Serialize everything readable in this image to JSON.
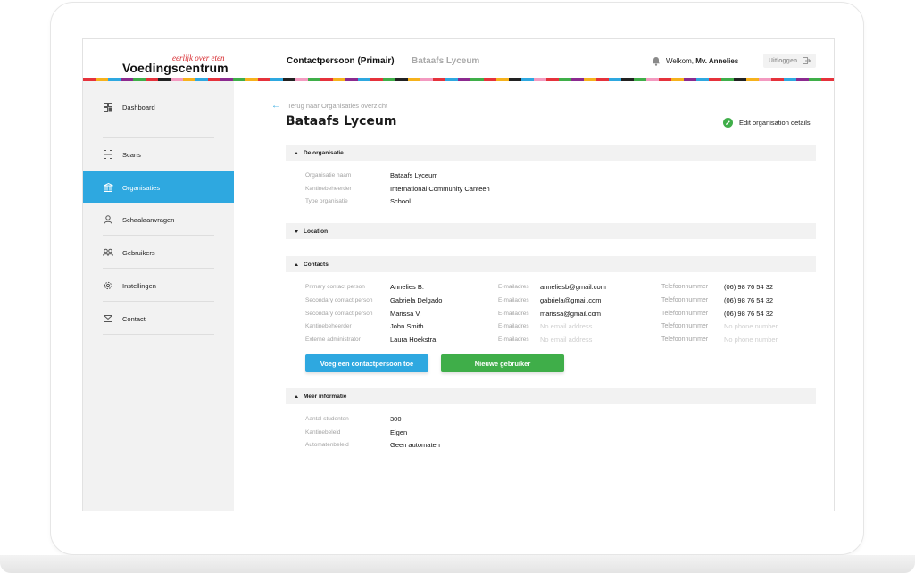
{
  "header": {
    "logo_tagline": "eerlijk over eten",
    "logo_name": "Voedingscentrum",
    "nav_primary": "Contactpersoon (Primair)",
    "nav_secondary": "Bataafs Lyceum",
    "welcome_prefix": "Welkom, ",
    "welcome_name": "Mv. Annelies",
    "logout_label": "Uitloggen",
    "stripe_colors": [
      "#e5323b",
      "#f6b21c",
      "#2ea8e0",
      "#8b2a8f",
      "#3fae49",
      "#e5323b",
      "#222222",
      "#f39ac0",
      "#f6b21c",
      "#2ea8e0",
      "#e5323b",
      "#8b2a8f",
      "#3fae49",
      "#f6b21c",
      "#e5323b",
      "#2ea8e0",
      "#222222",
      "#f39ac0",
      "#3fae49",
      "#e5323b",
      "#f6b21c",
      "#8b2a8f",
      "#2ea8e0",
      "#e5323b",
      "#3fae49",
      "#222222",
      "#f6b21c",
      "#f39ac0",
      "#e5323b",
      "#2ea8e0",
      "#8b2a8f",
      "#3fae49",
      "#e5323b",
      "#f6b21c",
      "#222222",
      "#2ea8e0",
      "#f39ac0",
      "#e5323b",
      "#3fae49",
      "#8b2a8f",
      "#f6b21c",
      "#e5323b",
      "#2ea8e0",
      "#222222",
      "#3fae49",
      "#f39ac0",
      "#e5323b",
      "#f6b21c",
      "#8b2a8f",
      "#2ea8e0",
      "#e5323b",
      "#3fae49",
      "#222222",
      "#f6b21c",
      "#f39ac0",
      "#e5323b",
      "#2ea8e0",
      "#8b2a8f",
      "#3fae49",
      "#e5323b"
    ]
  },
  "sidebar": {
    "items": [
      {
        "label": "Dashboard",
        "icon": "dashboard-icon"
      },
      {
        "label": "Scans",
        "icon": "scan-icon"
      },
      {
        "label": "Organisaties",
        "icon": "building-icon",
        "active": true
      },
      {
        "label": "Schaalaanvragen",
        "icon": "user-request-icon"
      },
      {
        "label": "Gebruikers",
        "icon": "users-icon"
      },
      {
        "label": "Instellingen",
        "icon": "gear-icon"
      },
      {
        "label": "Contact",
        "icon": "mail-icon"
      }
    ]
  },
  "main": {
    "back_link": "Terug naar Organisaties overzicht",
    "title": "Bataafs Lyceum",
    "edit_label": "Edit organisation details",
    "sections": {
      "organisatie": {
        "title": "De organisatie",
        "rows": [
          {
            "label": "Organisatie naam",
            "value": "Bataafs Lyceum"
          },
          {
            "label": "Kantinebeheerder",
            "value": "International Community Canteen"
          },
          {
            "label": "Type organisatie",
            "value": "School"
          }
        ]
      },
      "location": {
        "title": "Location"
      },
      "contacts": {
        "title": "Contacts",
        "email_label": "E-mailadres",
        "phone_label": "Telefoonnummer",
        "rows": [
          {
            "role": "Primary contact person",
            "name": "Annelies B.",
            "email": "anneliesb@gmail.com",
            "phone": "(06) 98 76 54 32"
          },
          {
            "role": "Secondary contact person",
            "name": "Gabriela Delgado",
            "email": "gabriela@gmail.com",
            "phone": "(06) 98 76 54 32"
          },
          {
            "role": "Secondary contact person",
            "name": "Marissa V.",
            "email": "marissa@gmail.com",
            "phone": "(06) 98 76 54 32"
          },
          {
            "role": "Kantinebeheerder",
            "name": "John Smith",
            "email": "No email address",
            "phone": "No phone number"
          },
          {
            "role": "Externe administrator",
            "name": "Laura Hoekstra",
            "email": "No email address",
            "phone": "No phone number"
          }
        ],
        "add_contact_button": "Voeg een contactpersoon toe",
        "new_user_button": "Nieuwe gebruiker"
      },
      "meer": {
        "title": "Meer informatie",
        "rows": [
          {
            "label": "Aantal studenten",
            "value": "300"
          },
          {
            "label": "Kantinebeleid",
            "value": "Eigen"
          },
          {
            "label": "Automatenbeleid",
            "value": "Geen automaten"
          }
        ]
      }
    }
  }
}
